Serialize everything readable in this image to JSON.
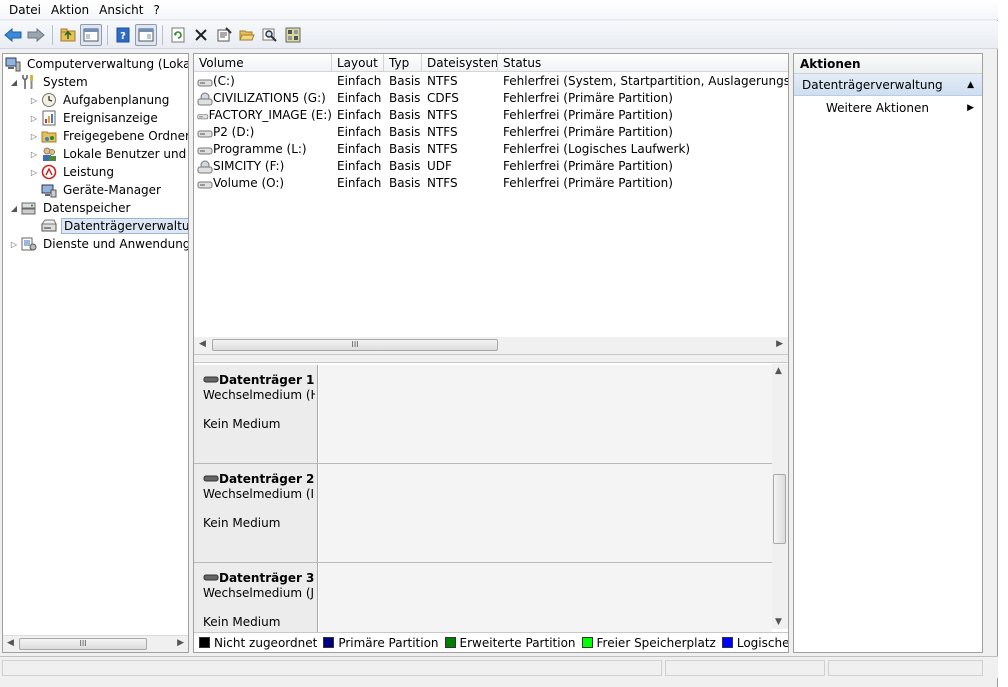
{
  "menu": [
    "Datei",
    "Aktion",
    "Ansicht",
    "?"
  ],
  "toolbar": {
    "icons": [
      "back-arrow-icon",
      "forward-arrow-icon",
      "up-folder-icon",
      "console-tree-icon",
      "help-icon",
      "action-pane-icon",
      "refresh-icon",
      "delete-icon",
      "properties-icon",
      "open-folder-icon",
      "search-icon",
      "disk-settings-icon"
    ]
  },
  "tree": {
    "items": [
      {
        "label": "Computerverwaltung (Lokal)"
      },
      {
        "label": "System"
      },
      {
        "label": "Aufgabenplanung"
      },
      {
        "label": "Ereignisanzeige"
      },
      {
        "label": "Freigegebene Ordner"
      },
      {
        "label": "Lokale Benutzer und Gru"
      },
      {
        "label": "Leistung"
      },
      {
        "label": "Geräte-Manager"
      },
      {
        "label": "Datenspeicher"
      },
      {
        "label": "Datenträgerverwaltung"
      },
      {
        "label": "Dienste und Anwendungen"
      }
    ],
    "hscroll_label": "III"
  },
  "volumes": {
    "headers": [
      "Volume",
      "Layout",
      "Typ",
      "Dateisystem",
      "Status"
    ],
    "rows": [
      {
        "volume": " (C:)",
        "layout": "Einfach",
        "typ": "Basis",
        "fs": "NTFS",
        "status": "Fehlerfrei (System, Startpartition, Auslagerungsdatei, A"
      },
      {
        "volume": "CIVILIZATION5 (G:)",
        "layout": "Einfach",
        "typ": "Basis",
        "fs": "CDFS",
        "status": "Fehlerfrei (Primäre Partition)"
      },
      {
        "volume": "FACTORY_IMAGE (E:)",
        "layout": "Einfach",
        "typ": "Basis",
        "fs": "NTFS",
        "status": "Fehlerfrei (Primäre Partition)"
      },
      {
        "volume": "P2 (D:)",
        "layout": "Einfach",
        "typ": "Basis",
        "fs": "NTFS",
        "status": "Fehlerfrei (Primäre Partition)"
      },
      {
        "volume": "Programme (L:)",
        "layout": "Einfach",
        "typ": "Basis",
        "fs": "NTFS",
        "status": "Fehlerfrei (Logisches Laufwerk)"
      },
      {
        "volume": "SIMCITY (F:)",
        "layout": "Einfach",
        "typ": "Basis",
        "fs": "UDF",
        "status": "Fehlerfrei (Primäre Partition)"
      },
      {
        "volume": "Volume (O:)",
        "layout": "Einfach",
        "typ": "Basis",
        "fs": "NTFS",
        "status": "Fehlerfrei (Primäre Partition)"
      }
    ],
    "hscroll_label": "III"
  },
  "disks": [
    {
      "name": "Datenträger 1",
      "type": "Wechselmedium (H:",
      "media": "Kein Medium"
    },
    {
      "name": "Datenträger 2",
      "type": "Wechselmedium (I:)",
      "media": "Kein Medium"
    },
    {
      "name": "Datenträger 3",
      "type": "Wechselmedium (J:)",
      "media": "Kein Medium"
    }
  ],
  "legend": [
    {
      "label": "Nicht zugeordnet",
      "color": "#000000"
    },
    {
      "label": "Primäre Partition",
      "color": "#00007f"
    },
    {
      "label": "Erweiterte Partition",
      "color": "#008000"
    },
    {
      "label": "Freier Speicherplatz",
      "color": "#00ff00"
    },
    {
      "label": "Logisches Laufwerk",
      "color": "#0000ff"
    }
  ],
  "actions": {
    "title": "Aktionen",
    "group": "Datenträgerverwaltung",
    "link": "Weitere Aktionen"
  }
}
